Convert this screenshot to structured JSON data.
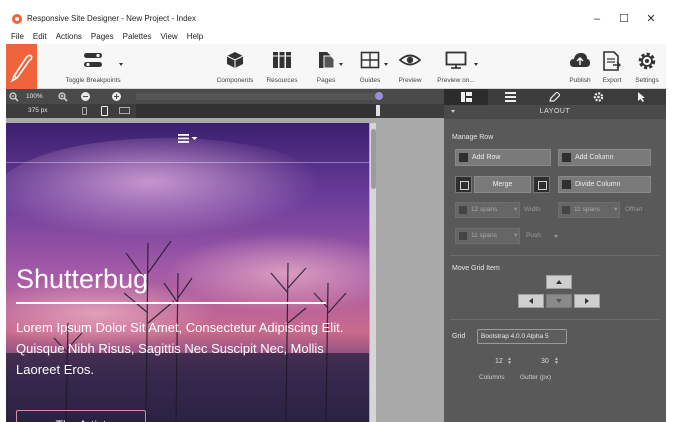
{
  "window": {
    "title": "Responsive Site Designer - New Project - Index",
    "controls": {
      "minimize": "–",
      "maximize": "☐",
      "close": "✕"
    }
  },
  "menu": [
    "File",
    "Edit",
    "Actions",
    "Pages",
    "Palettes",
    "View",
    "Help"
  ],
  "toolbar": {
    "toggle_breakpoints": "Toggle Breakpoints",
    "components": "Components",
    "resources": "Resources",
    "pages": "Pages",
    "guides": "Guides",
    "preview": "Preview",
    "preview_on": "Preview on...",
    "publish": "Publish",
    "export": "Export",
    "settings": "Settings"
  },
  "zoom": {
    "level": "100%",
    "width": "375 px"
  },
  "canvas": {
    "hero_title": "Shutterbug",
    "hero_text": "Lorem Ipsum Dolor Sit Amet, Consectetur Adipiscing Elit. Quisque Nibh Risus, Sagittis Nec Suscipit Nec, Mollis Laoreet Eros.",
    "cta": "The Artist"
  },
  "panel": {
    "header": "LAYOUT",
    "tabs": [
      "layout-icon",
      "list-icon",
      "pen-icon",
      "gear-icon",
      "cursor-icon"
    ],
    "manage_row": {
      "title": "Manage Row",
      "add_row": "Add Row",
      "add_column": "Add Column",
      "merge": "Merge",
      "divide_column": "Divide Column",
      "span1": "12 spans",
      "width_label": "Width",
      "span2": "11 spans",
      "offset_label": "Offset",
      "span3": "11 spans",
      "push_label": "Push"
    },
    "move_grid": {
      "title": "Move Grid Item"
    },
    "grid": {
      "label": "Grid",
      "framework": "Bootstrap 4.0.0 Alpha 5",
      "columns_value": "12",
      "columns_label": "Columns",
      "gutter_value": "30",
      "gutter_label": "Gutter (px)"
    }
  },
  "colors": {
    "accent": "#f0643c",
    "panel_bg": "#595959",
    "panel_dark": "#3c3c3c",
    "toolbar_bg": "#f7f7f7",
    "slider_dot": "#9a8fd8"
  }
}
